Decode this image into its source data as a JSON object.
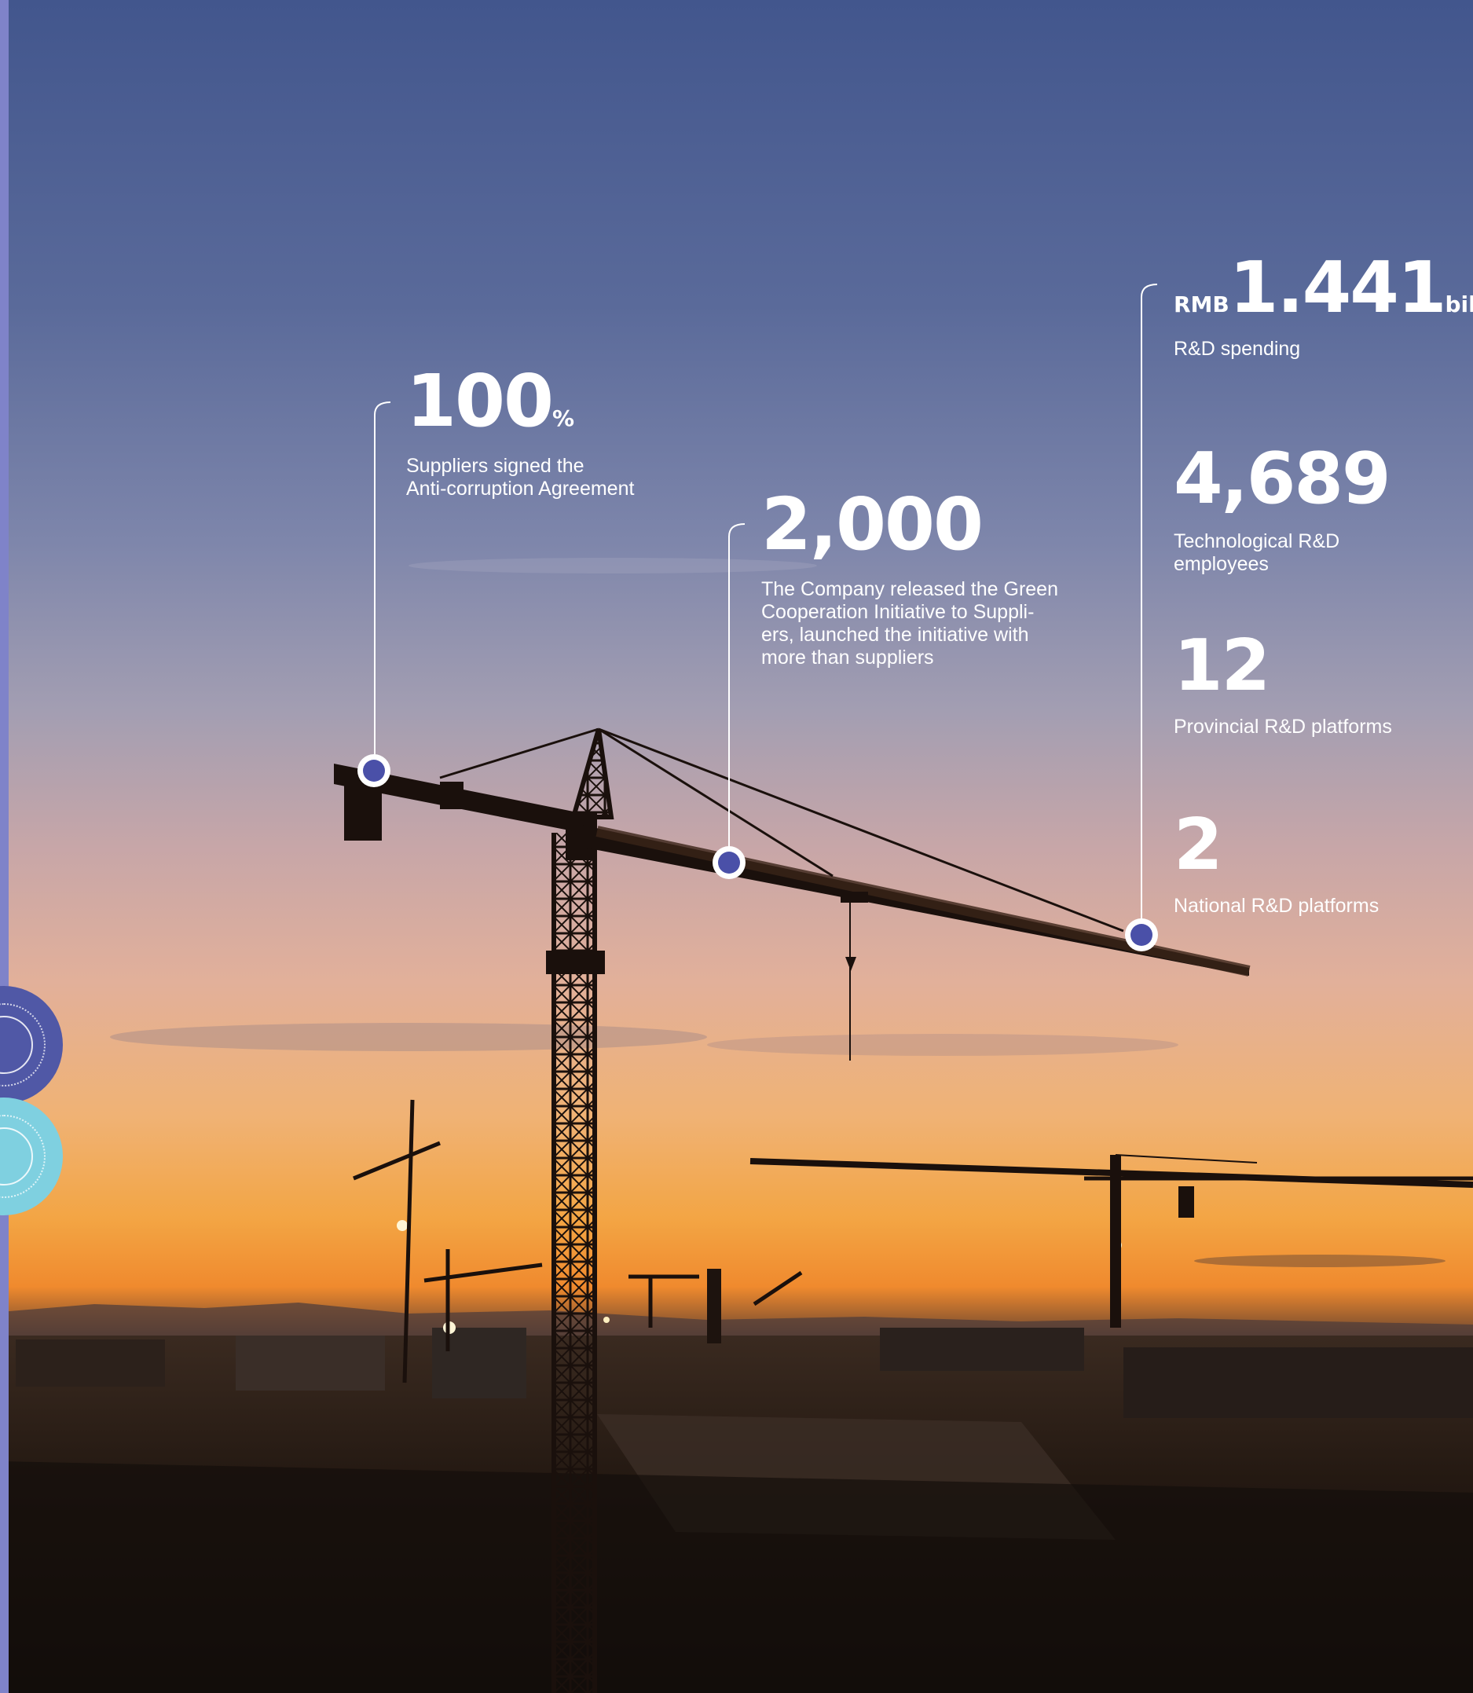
{
  "colors": {
    "sky_top": "#44588f",
    "sky_mid": "#c9a2a2",
    "sunset_orange": "#f2a13a",
    "ground_dark": "#1c130f",
    "marker_fill": "#4a50a8",
    "side_disc_blue": "#5058a6",
    "side_disc_cyan": "#7fd0e0"
  },
  "icons": {
    "marker": "circle-marker-icon",
    "side_disc_1": "concentric-circle-icon",
    "side_disc_2": "concentric-circle-icon"
  },
  "stats": {
    "suppliers_pct": {
      "value": "100",
      "unit": "%",
      "desc_line1": "Suppliers signed the",
      "desc_line2": "Anti-corruption Agreement"
    },
    "green_initiative": {
      "value": "2,000",
      "desc_line1": "The Company released the Green",
      "desc_line2": "Cooperation Initiative to Suppli-",
      "desc_line3": "ers, launched the initiative with",
      "desc_line4": "more than suppliers"
    },
    "rd_spending": {
      "prefix": "RMB",
      "value": "1.441",
      "suffix": "billion",
      "desc": "R&D spending"
    },
    "rd_employees": {
      "value": "4,689",
      "desc_line1": "Technological R&D",
      "desc_line2": "employees"
    },
    "provincial_platforms": {
      "value": "12",
      "desc": "Provincial R&D platforms"
    },
    "national_platforms": {
      "value": "2",
      "desc": "National R&D platforms"
    }
  }
}
